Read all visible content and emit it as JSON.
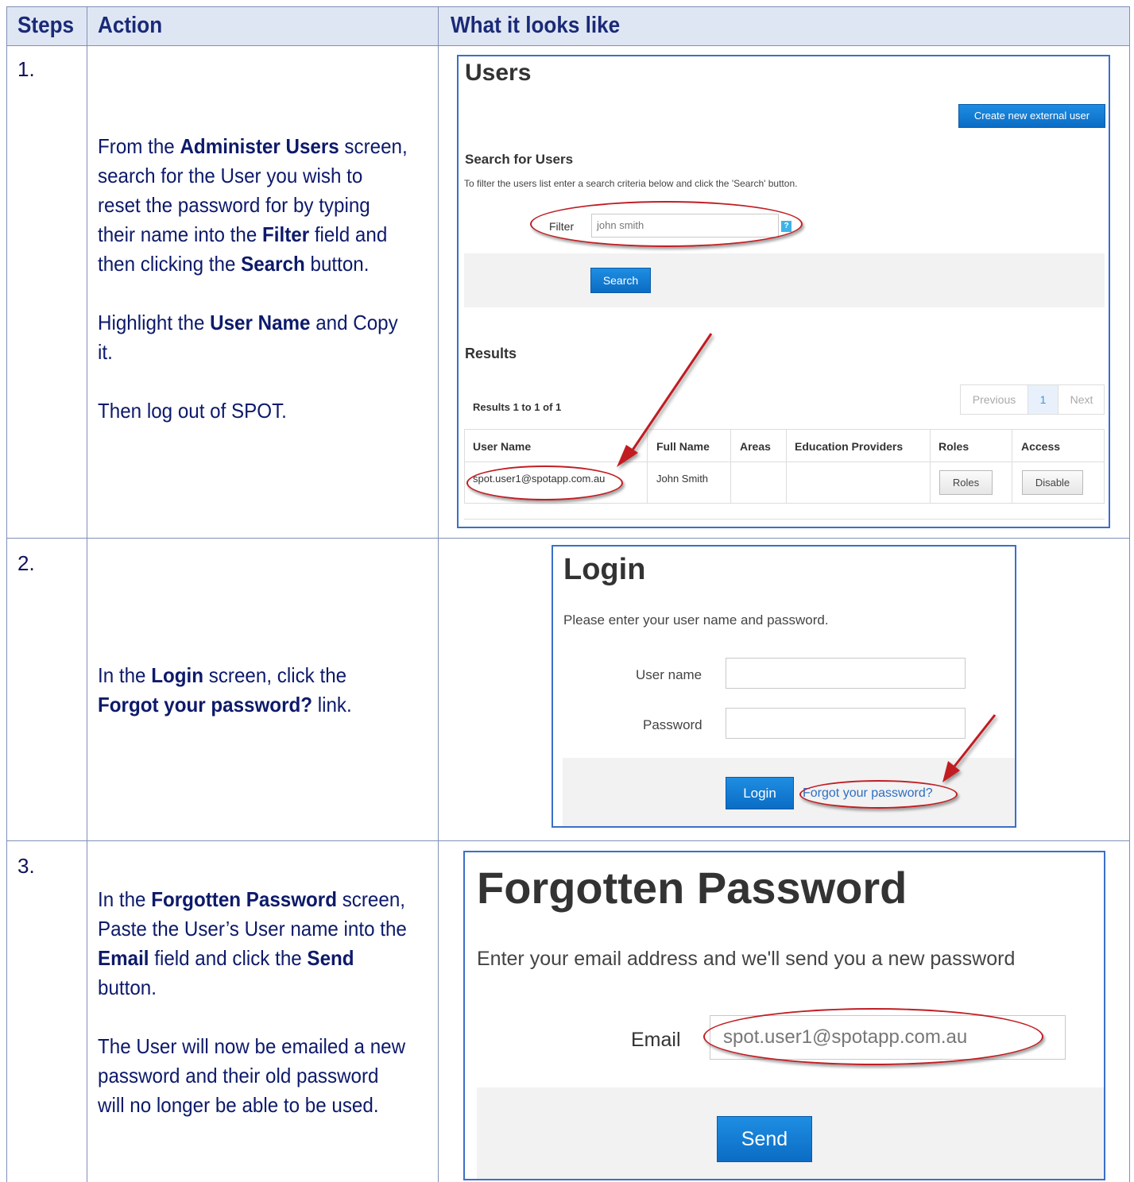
{
  "table": {
    "headers": [
      "Steps",
      "Action",
      "What it looks like"
    ],
    "steps": [
      {
        "number": "1.",
        "paragraphs": [
          [
            {
              "t": "From the "
            },
            {
              "t": "Administer Users",
              "b": true
            },
            {
              "t": " screen, search for the User you wish to reset the password for by typing their name into the "
            },
            {
              "t": "Filter",
              "b": true
            },
            {
              "t": " field and then clicking the "
            },
            {
              "t": "Search",
              "b": true
            },
            {
              "t": " button."
            }
          ],
          [
            {
              "t": "Highlight the "
            },
            {
              "t": "User Name",
              "b": true
            },
            {
              "t": " and Copy it."
            }
          ],
          [
            {
              "t": "Then log out of SPOT."
            }
          ]
        ]
      },
      {
        "number": "2.",
        "paragraphs": [
          [
            {
              "t": "In the "
            },
            {
              "t": "Login",
              "b": true
            },
            {
              "t": " screen, click the "
            },
            {
              "t": "Forgot your password?",
              "b": true
            },
            {
              "t": " link."
            }
          ]
        ]
      },
      {
        "number": "3.",
        "paragraphs": [
          [
            {
              "t": "In the "
            },
            {
              "t": "Forgotten Password",
              "b": true
            },
            {
              "t": " screen, Paste the User’s User name into the "
            },
            {
              "t": "Email",
              "b": true
            },
            {
              "t": " field and click the "
            },
            {
              "t": "Send",
              "b": true
            },
            {
              "t": " button."
            }
          ],
          [
            {
              "t": "The User will now be emailed a new password and their old password will no longer be able to be used."
            }
          ]
        ]
      }
    ]
  },
  "users_screen": {
    "title": "Users",
    "create_button": "Create new external user",
    "search_heading": "Search for Users",
    "search_hint": "To filter the users list enter a search criteria below and click the 'Search' button.",
    "filter_label": "Filter",
    "filter_value": "john smith",
    "help_icon": "?",
    "search_button": "Search",
    "results_heading": "Results",
    "results_count": "Results 1 to 1 of 1",
    "pager": {
      "previous": "Previous",
      "page": "1",
      "next": "Next"
    },
    "columns": [
      "User Name",
      "Full Name",
      "Areas",
      "Education Providers",
      "Roles",
      "Access"
    ],
    "row": {
      "user_name": "spot.user1@spotapp.com.au",
      "full_name": "John Smith",
      "areas": "",
      "education_providers": "",
      "roles_button": "Roles",
      "access_button": "Disable"
    }
  },
  "login_screen": {
    "title": "Login",
    "instruction": "Please enter your user name and password.",
    "username_label": "User name",
    "password_label": "Password",
    "login_button": "Login",
    "forgot_link": "Forgot your password?"
  },
  "forgot_screen": {
    "title": "Forgotten Password",
    "instruction": "Enter your email address and we'll send you a new password",
    "email_label": "Email",
    "email_value": "spot.user1@spotapp.com.au",
    "send_button": "Send"
  },
  "colors": {
    "annotation_red": "#c01e24",
    "button_blue": "#0b6cc4",
    "header_fill": "#dfe6f3",
    "grid_line": "#7f8fb8"
  }
}
